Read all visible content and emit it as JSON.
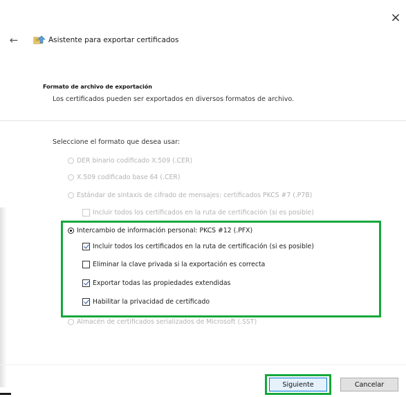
{
  "window": {
    "close_glyph": "×",
    "back_glyph": "←",
    "title": "Asistente para exportar certificados"
  },
  "header": {
    "heading": "Formato de archivo de exportación",
    "description": "Los certificados pueden ser exportados en diversos formatos de archivo."
  },
  "prompt": "Seleccione el formato que desea usar:",
  "options": [
    {
      "label": "DER binario codificado X.509 (.CER)",
      "kind": "radio",
      "checked": false,
      "enabled": false
    },
    {
      "label": "X.509 codificado base 64 (.CER)",
      "kind": "radio",
      "checked": false,
      "enabled": false
    },
    {
      "label": "Estándar de sintaxis de cifrado de mensajes: certificados PKCS #7 (.P7B)",
      "kind": "radio",
      "checked": false,
      "enabled": false
    },
    {
      "label": "Incluir todos los certificados en la ruta de certificación (si es posible)",
      "kind": "checkbox",
      "checked": false,
      "enabled": false
    },
    {
      "label": "Intercambio de información personal: PKCS #12 (.PFX)",
      "kind": "radio",
      "checked": true,
      "enabled": true
    },
    {
      "label": "Incluir todos los certificados en la ruta de certificación (si es posible)",
      "kind": "checkbox",
      "checked": true,
      "enabled": true
    },
    {
      "label": "Eliminar la clave privada si la exportación es correcta",
      "kind": "checkbox",
      "checked": false,
      "enabled": true
    },
    {
      "label": "Exportar todas las propiedades extendidas",
      "kind": "checkbox",
      "checked": true,
      "enabled": true
    },
    {
      "label": "Habilitar la privacidad de certificado",
      "kind": "checkbox",
      "checked": true,
      "enabled": true
    },
    {
      "label": "Almacén de certificados serializados de Microsoft (.SST)",
      "kind": "radio",
      "checked": false,
      "enabled": false
    }
  ],
  "buttons": {
    "next": "Siguiente",
    "cancel": "Cancelar"
  },
  "colors": {
    "highlight": "#14a83b",
    "check": "#1e4e9c"
  }
}
